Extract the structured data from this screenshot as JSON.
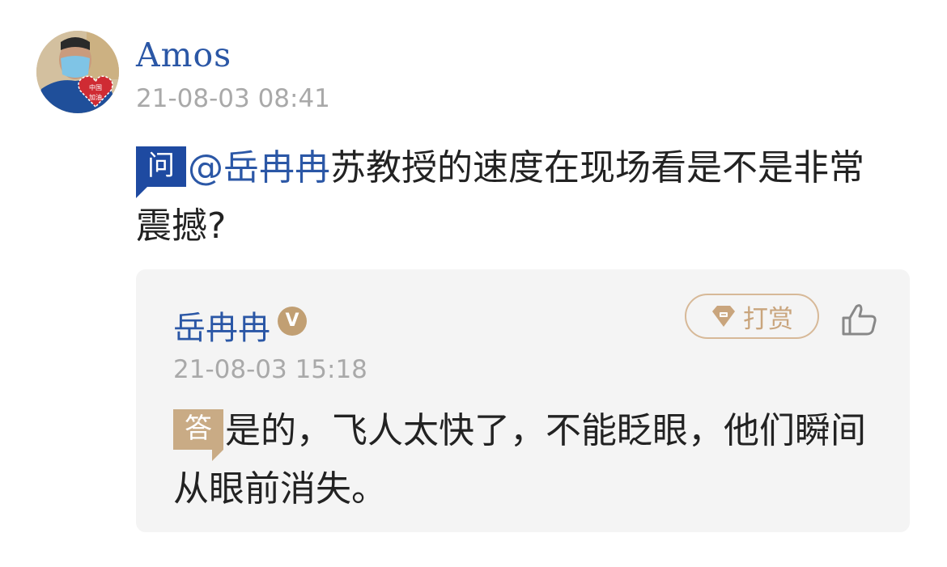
{
  "question": {
    "user": "Amos",
    "time": "21-08-03 08:41",
    "tag": "问",
    "mention": "@岳冉冉",
    "text": "苏教授的速度在现场看是不是非常震撼?"
  },
  "answer": {
    "user": "岳冉冉",
    "verified_badge": "V",
    "tip_label": "打赏",
    "time": "21-08-03 15:18",
    "tag": "答",
    "text": "是的，飞人太快了，不能眨眼，他们瞬间从眼前消失。"
  },
  "avatar_badge": {
    "line1": "中国",
    "line2": "加油"
  },
  "colors": {
    "link_blue": "#2b57a6",
    "question_tag": "#1e4aa1",
    "answer_tag": "#c9ab85",
    "gold": "#c9a57d",
    "answer_bg": "#f4f4f4"
  },
  "icons": [
    "avatar",
    "verified-icon",
    "tip-diamond-icon",
    "thumbs-up-icon"
  ]
}
